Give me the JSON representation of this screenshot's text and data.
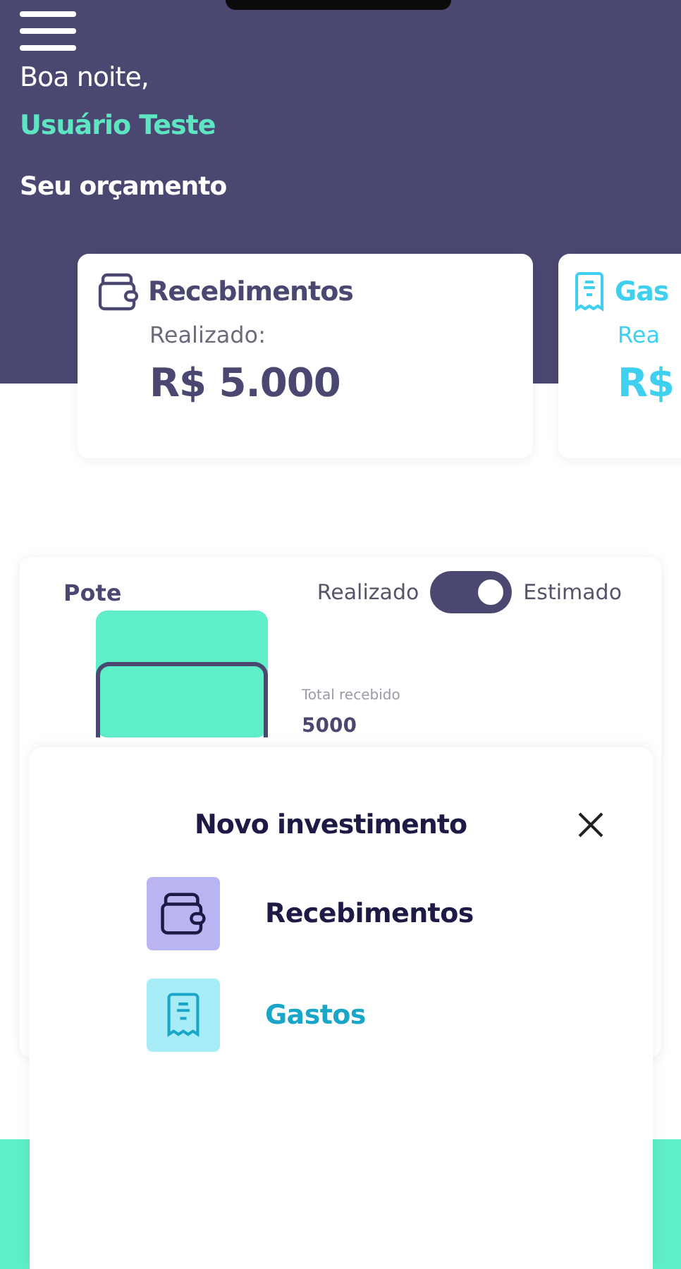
{
  "greeting": "Boa noite,",
  "user_name": "Usuário Teste",
  "section_title": "Seu orçamento",
  "budget_cards": [
    {
      "kind": "income",
      "title": "Recebimentos",
      "label": "Realizado:",
      "value": "R$ 5.000"
    },
    {
      "kind": "expense",
      "title": "Gas",
      "label": "Rea",
      "value": "R$"
    }
  ],
  "pot": {
    "title": "Pote",
    "toggle": {
      "left_label": "Realizado",
      "on": true,
      "right_label": "Estimado"
    },
    "total_label": "Total recebido",
    "total_value": "5000"
  },
  "sheet": {
    "title": "Novo investimento",
    "options": [
      {
        "kind": "income",
        "label": "Recebimentos"
      },
      {
        "kind": "expense",
        "label": "Gastos"
      }
    ]
  }
}
